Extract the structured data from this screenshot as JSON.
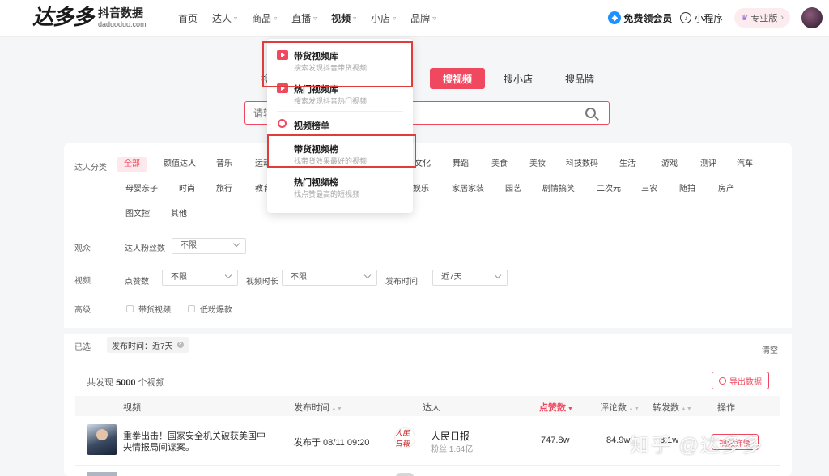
{
  "brand": {
    "logo": "达多多",
    "name_cn": "抖音数据",
    "domain": "daduoduo.com"
  },
  "nav": [
    {
      "label": "首页",
      "has_caret": false
    },
    {
      "label": "达人",
      "has_caret": true
    },
    {
      "label": "商品",
      "has_caret": true
    },
    {
      "label": "直播",
      "has_caret": true
    },
    {
      "label": "视频",
      "has_caret": true
    },
    {
      "label": "小店",
      "has_caret": true
    },
    {
      "label": "品牌",
      "has_caret": true
    }
  ],
  "header_right": {
    "vip": "免费领会员",
    "mini": "小程序",
    "pro": "专业版",
    "pro_arrow": "›"
  },
  "search_tabs": {
    "partial": "搜",
    "video": "搜视频",
    "shop": "搜小店",
    "brand": "搜品牌"
  },
  "search": {
    "placeholder": "请输"
  },
  "dropdown": {
    "items": [
      {
        "title": "带货视频库",
        "desc": "搜索发现抖音带货视频"
      },
      {
        "title": "热门视频库",
        "desc": "搜索发现抖音热门视频"
      },
      {
        "title": "视频榜单",
        "desc": ""
      },
      {
        "title": "带货视频榜",
        "desc": "找带货效果最好的视频"
      },
      {
        "title": "热门视频榜",
        "desc": "找点赞最高的短视频"
      }
    ]
  },
  "filters": {
    "category_label": "达人分类",
    "categories_row1": [
      "全部",
      "颜值达人",
      "音乐",
      "运动",
      "文化",
      "舞蹈",
      "美食",
      "美妆",
      "科技数码",
      "生活",
      "游戏",
      "测评",
      "汽车"
    ],
    "categories_row2": [
      "母婴亲子",
      "时尚",
      "旅行",
      "教育",
      "娱乐",
      "家居家装",
      "园艺",
      "剧情搞笑",
      "二次元",
      "三农",
      "随拍",
      "房产"
    ],
    "categories_row3": [
      "图文控",
      "其他"
    ],
    "audience_label": "观众",
    "fans_label": "达人粉丝数",
    "fans_value": "不限",
    "video_label": "视频",
    "likes_label": "点赞数",
    "likes_value": "不限",
    "duration_label": "视频时长",
    "duration_value": "不限",
    "publish_label": "发布时间",
    "publish_value": "近7天",
    "advanced_label": "高级",
    "cb_goods": "带货视频",
    "cb_lowfans": "低粉爆款",
    "selected_label": "已选",
    "selected_chip": "发布时间：近7天",
    "selected_chip_x": "×",
    "clear": "清空"
  },
  "results": {
    "prefix": "共发现",
    "count": "5000",
    "suffix": "个视频",
    "export": "导出数据"
  },
  "table": {
    "headers": {
      "video": "视频",
      "publish": "发布时间",
      "kol": "达人",
      "likes": "点赞数",
      "comments": "评论数",
      "shares": "转发数",
      "ops": "操作"
    },
    "rows": [
      {
        "title": "重拳出击！国家安全机关破获美国中央情报局间谍案。",
        "publish": "发布于 08/11 09:20",
        "kol_avatar": "人民日報",
        "kol_name": "人民日报",
        "kol_fans": "粉丝 1.64亿",
        "likes": "747.8w",
        "comments": "84.9w",
        "shares": "3.1w",
        "op": "视频详情"
      }
    ]
  },
  "watermark": "知乎 @达多多",
  "colors": {
    "accent": "#f0495f",
    "highlight": "#e03c3c"
  }
}
